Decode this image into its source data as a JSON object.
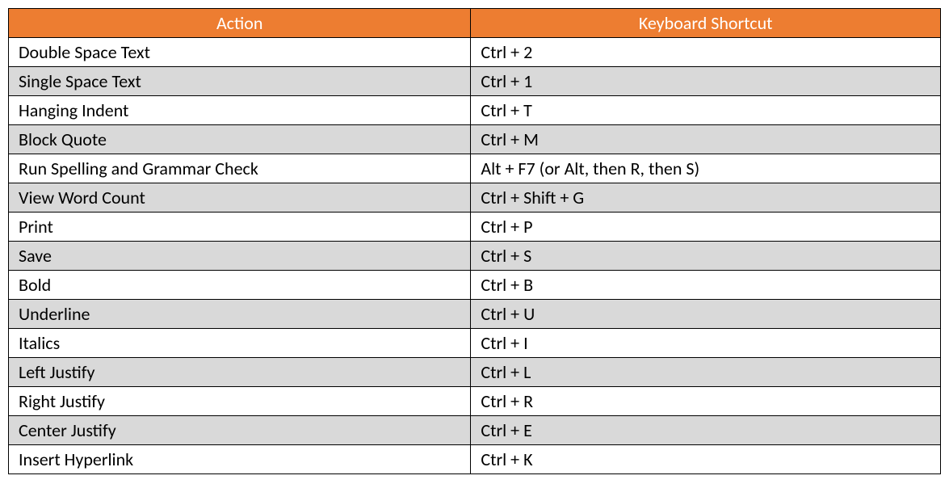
{
  "table": {
    "headers": {
      "action": "Action",
      "shortcut": "Keyboard Shortcut"
    },
    "rows": [
      {
        "action": "Double Space Text",
        "shortcut": "Ctrl + 2"
      },
      {
        "action": "Single Space Text",
        "shortcut": "Ctrl + 1"
      },
      {
        "action": "Hanging Indent",
        "shortcut": "Ctrl + T"
      },
      {
        "action": "Block Quote",
        "shortcut": "Ctrl + M"
      },
      {
        "action": "Run Spelling and Grammar Check",
        "shortcut": "Alt + F7 (or Alt, then R, then S)"
      },
      {
        "action": "View Word Count",
        "shortcut": "Ctrl + Shift + G"
      },
      {
        "action": "Print",
        "shortcut": "Ctrl + P"
      },
      {
        "action": "Save",
        "shortcut": "Ctrl + S"
      },
      {
        "action": "Bold",
        "shortcut": "Ctrl + B"
      },
      {
        "action": "Underline",
        "shortcut": "Ctrl + U"
      },
      {
        "action": "Italics",
        "shortcut": "Ctrl + I"
      },
      {
        "action": "Left Justify",
        "shortcut": "Ctrl + L"
      },
      {
        "action": "Right Justify",
        "shortcut": "Ctrl + R"
      },
      {
        "action": "Center Justify",
        "shortcut": "Ctrl + E"
      },
      {
        "action": "Insert Hyperlink",
        "shortcut": "Ctrl + K"
      }
    ]
  }
}
